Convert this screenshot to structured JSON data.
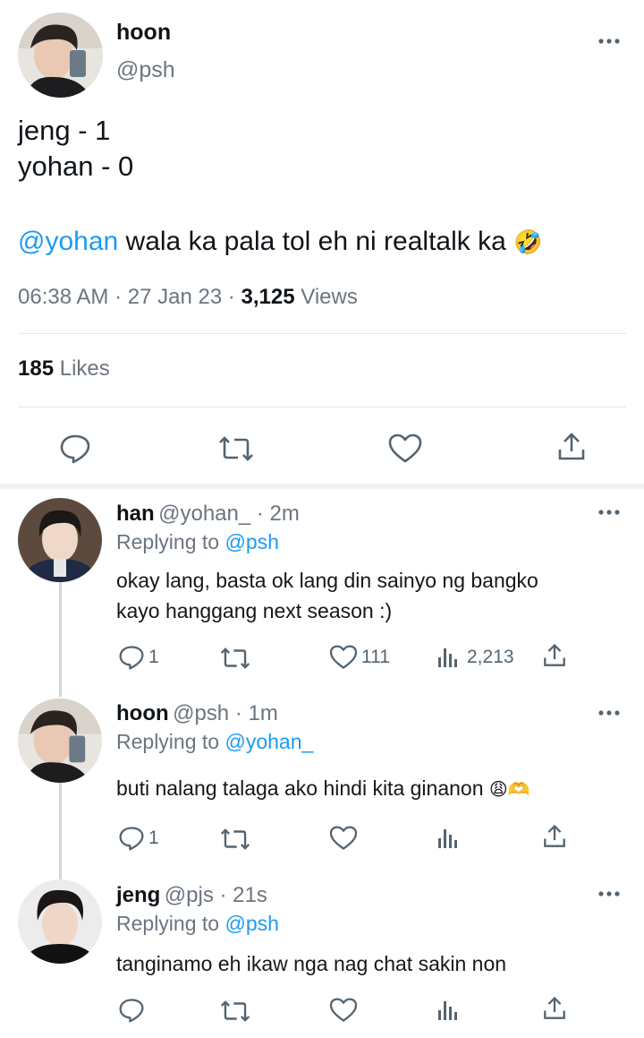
{
  "main_tweet": {
    "name": "hoon",
    "handle": "@psh",
    "lines": [
      "jeng - 1",
      "yohan - 0"
    ],
    "mention": "@yohan",
    "text": " wala ka pala tol eh ni realtalk ka",
    "emoji": "🤣",
    "time": "06:38 AM",
    "dot": "·",
    "date": "27 Jan 23",
    "views_count": "3,125",
    "views_label": "Views",
    "likes_count": "185",
    "likes_label": "Likes",
    "action_icons": [
      "reply-icon",
      "retweet-icon",
      "like-icon",
      "share-icon"
    ]
  },
  "replies": [
    {
      "name": "han",
      "meta": "@yohan_ · 2m",
      "replying_prefix": "Replying to",
      "replying_to": "@psh",
      "text_lines": [
        "okay lang, basta ok lang din sainyo ng bangko",
        "kayo hanggang next season :)"
      ],
      "reply_count": "1",
      "like_count": "111",
      "views": "2,213"
    },
    {
      "name": "hoon",
      "meta": "@psh · 1m",
      "replying_prefix": "Replying to",
      "replying_to": "@yohan_",
      "text_lines": [
        "buti nalang talaga ako hindi kita ginanon"
      ],
      "emoji": "😩🫶",
      "reply_count": "1"
    },
    {
      "name": "jeng",
      "meta": "@pjs · 21s",
      "replying_prefix": "Replying to",
      "replying_to": "@psh",
      "text_lines": [
        "tanginamo eh ikaw nga nag chat sakin non"
      ]
    }
  ]
}
